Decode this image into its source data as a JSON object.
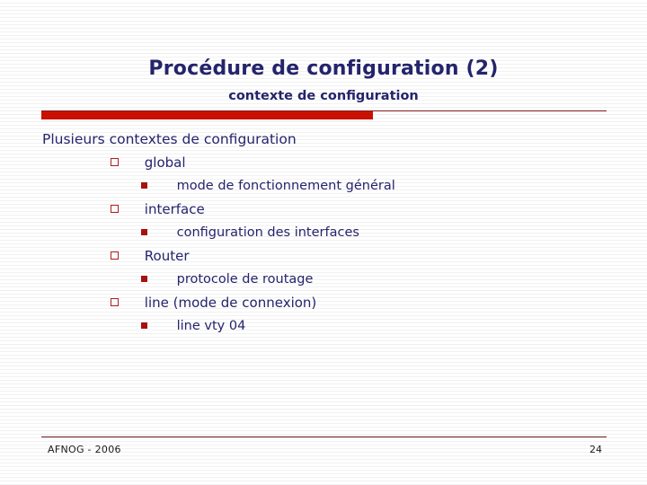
{
  "slide": {
    "title": "Procédure de configuration (2)",
    "subtitle": "contexte de configuration",
    "colors": {
      "title_text": "#25246e",
      "body_text": "#25246e",
      "accent_bar": "#cc1100",
      "rule": "#8a1a18",
      "bullet_hollow": "#b02020",
      "bullet_filled": "#aa1111",
      "background": "#ffffff",
      "footer_text": "#1a1a1a"
    },
    "bullets": [
      {
        "level": 1,
        "marker": "none",
        "text": "Plusieurs contextes de configuration"
      },
      {
        "level": 2,
        "marker": "hollow-square-bullet",
        "text": "global"
      },
      {
        "level": 3,
        "marker": "filled-square-bullet",
        "text": "mode de fonctionnement général"
      },
      {
        "level": 2,
        "marker": "hollow-square-bullet",
        "text": "interface"
      },
      {
        "level": 3,
        "marker": "filled-square-bullet",
        "text": "configuration des interfaces"
      },
      {
        "level": 2,
        "marker": "hollow-square-bullet",
        "text": "Router"
      },
      {
        "level": 3,
        "marker": "filled-square-bullet",
        "text": "protocole de routage"
      },
      {
        "level": 2,
        "marker": "hollow-square-bullet",
        "text": "line (mode de connexion)"
      },
      {
        "level": 3,
        "marker": "filled-square-bullet",
        "text": "line vty 04"
      }
    ],
    "footer": {
      "left": "AFNOG - 2006",
      "page_number": "24"
    }
  }
}
